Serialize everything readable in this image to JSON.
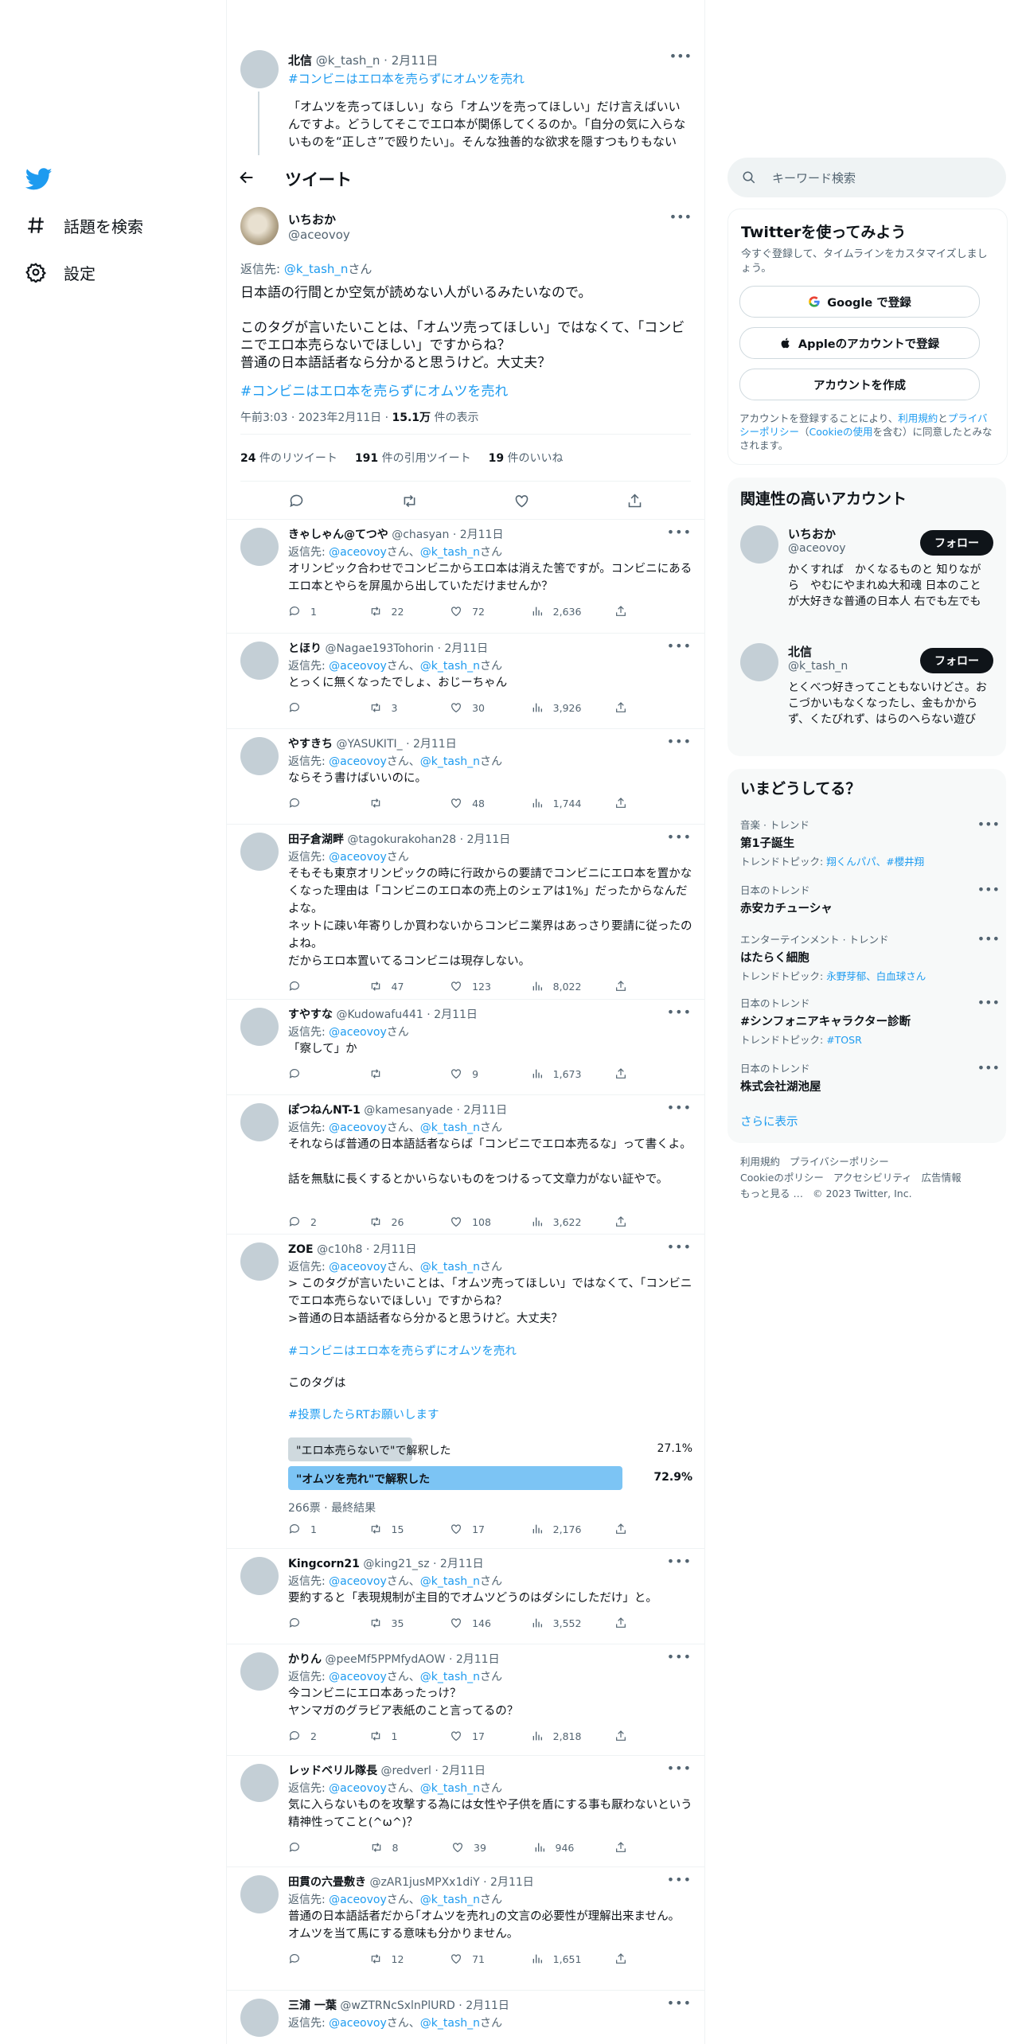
{
  "colors": {
    "accent": "#1d9bf0",
    "text": "#0f1419",
    "muted": "#536471",
    "poll_winner": "#7cc4f4",
    "poll_other": "#cfd9de"
  },
  "nav": {
    "explore": "話題を検索",
    "settings": "設定"
  },
  "parent": {
    "name": "北信",
    "handle": "@k_tash_n",
    "date": "· 2月11日",
    "hashtag": "#コンビニはエロ本を売らずにオムツを売れ",
    "text": "「オムツを売ってほしい」なら「オムツを売ってほしい」だけ言えばいいんですよ。どうしてそこでエロ本が関係してくるのか。「自分の気に入らないものを“正しさ”で殴りたい」。そんな独善的な欲求を隠すつもりもないんですね。"
  },
  "header": {
    "title": "ツイート"
  },
  "main": {
    "name": "いちおか",
    "handle": "@aceovoy",
    "reply_prefix": "返信先: ",
    "reply_to": "@k_tash_n",
    "reply_suffix": "さん",
    "line1": "日本語の行間とか空気が読めない人がいるみたいなので。",
    "line2": "このタグが言いたいことは、「オムツ売ってほしい」ではなくて、「コンビニでエロ本売らないでほしい」ですからね？",
    "line3": "普通の日本語話者なら分かると思うけど。大丈夫？",
    "hashtag": "#コンビニはエロ本を売らずにオムツを売れ",
    "time": "午前3:03 · 2023年2月11日 · ",
    "views": "15.1万",
    "views_suffix": " 件の表示",
    "retweets": "24",
    "retweets_label": " 件のリツイート",
    "quotes": "191",
    "quotes_label": " 件の引用ツイート",
    "likes": "19",
    "likes_label": " 件のいいね"
  },
  "replies": [
    {
      "name": "きゃしゃん@てつや",
      "handle": "@chasyan",
      "date": "· 2月11日",
      "to": [
        "@aceovoy",
        "@k_tash_n"
      ],
      "text": "オリンピック合わせでコンビニからエロ本は消えた筈ですが。コンビニにあるエロ本とやらを屏風から出していただけませんか？",
      "reply": "1",
      "rt": "22",
      "like": "72",
      "views": "2,636"
    },
    {
      "name": "とほり",
      "handle": "@Nagae193Tohorin",
      "date": "· 2月11日",
      "to": [
        "@aceovoy",
        "@k_tash_n"
      ],
      "text": "とっくに無くなったでしょ、おじーちゃん",
      "reply": "",
      "rt": "3",
      "like": "30",
      "views": "3,926"
    },
    {
      "name": "やすきち",
      "handle": "@YASUKITI_",
      "date": "· 2月11日",
      "to": [
        "@aceovoy",
        "@k_tash_n"
      ],
      "text": "ならそう書けばいいのに。",
      "reply": "",
      "rt": "",
      "like": "48",
      "views": "1,744"
    },
    {
      "name": "田子倉湖畔",
      "handle": "@tagokurakohan28",
      "date": "· 2月11日",
      "to": [
        "@aceovoy"
      ],
      "text": "そもそも東京オリンピックの時に行政からの要請でコンビニにエロ本を置かなくなった理由は「コンビニのエロ本の売上のシェアは1%」だったからなんだよな。\nネットに疎い年寄りしか買わないからコンビニ業界はあっさり要請に従ったのよね。\nだからエロ本置いてるコンビニは現存しない。",
      "reply": "",
      "rt": "47",
      "like": "123",
      "views": "8,022"
    },
    {
      "name": "すやすな",
      "handle": "@Kudowafu441",
      "date": "· 2月11日",
      "to": [
        "@aceovoy"
      ],
      "text": "「察して」か",
      "reply": "",
      "rt": "",
      "like": "9",
      "views": "1,673"
    },
    {
      "name": "ぽつねんNT-1",
      "handle": "@kamesanyade",
      "date": "· 2月11日",
      "to": [
        "@aceovoy",
        "@k_tash_n"
      ],
      "text": "それならば普通の日本語話者ならば「コンビニでエロ本売るな」って書くよ。\n\n話を無駄に長くするとかいらないものをつけるって文章力がない証やで。",
      "reply": "2",
      "rt": "26",
      "like": "108",
      "views": "3,622"
    },
    {
      "name": "ZOE",
      "handle": "@c10h8",
      "date": "· 2月11日",
      "to": [
        "@aceovoy",
        "@k_tash_n"
      ],
      "text": "> このタグが言いたいことは、「オムツ売ってほしい」ではなくて、「コンビニでエロ本売らないでほしい」ですからね？\n>普通の日本語話者なら分かると思うけど。大丈夫？",
      "reply": "1",
      "rt": "15",
      "like": "17",
      "views": "2,176"
    },
    {
      "name": "Kingcorn21",
      "handle": "@king21_sz",
      "date": "· 2月11日",
      "to": [
        "@aceovoy",
        "@k_tash_n"
      ],
      "text": "要約すると「表現規制が主目的でオムツどうのはダシにしただけ」と。",
      "reply": "",
      "rt": "35",
      "like": "146",
      "views": "3,552"
    },
    {
      "name": "かりん",
      "handle": "@peeMf5PPMfydAOW",
      "date": "· 2月11日",
      "to": [
        "@aceovoy",
        "@k_tash_n"
      ],
      "text": "今コンビニにエロ本あったっけ？\nヤンマガのグラビア表紙のこと言ってるの？",
      "reply": "2",
      "rt": "1",
      "like": "17",
      "views": "2,818"
    },
    {
      "name": "レッドベリル隊長",
      "handle": "@redverl",
      "date": "· 2月11日",
      "to": [
        "@aceovoy",
        "@k_tash_n"
      ],
      "text": "気に入らないものを攻撃する為には女性や子供を盾にする事も厭わないという精神性ってこと(^ω^)？",
      "reply": "",
      "rt": "8",
      "like": "39",
      "views": "946"
    },
    {
      "name": "田貫の六畳敷き",
      "handle": "@zAR1jusMPXx1diY",
      "date": "· 2月11日",
      "to": [
        "@aceovoy",
        "@k_tash_n"
      ],
      "text": "普通の日本語話者だから｢オムツを売れ｣の文言の必要性が理解出来ません。\nオムツを当て馬にする意味も分かりません。",
      "reply": "",
      "rt": "12",
      "like": "71",
      "views": "1,651"
    },
    {
      "name": "三浦 一葉",
      "handle": "@wZTRNcSxlnPlURD",
      "date": "· 2月11日",
      "to": [
        "@aceovoy",
        "@k_tash_n"
      ],
      "text": "",
      "reply": "",
      "rt": "",
      "like": "",
      "views": ""
    }
  ],
  "zoe_extra": {
    "hashtag": "#コンビニはエロ本を売らずにオムツを売れ",
    "line": "このタグは",
    "hashtag2": "#投票したらRTお願いします",
    "poll": [
      {
        "label": "\"エロ本売らないで\"で解釈した",
        "pct": "27.1%",
        "value": 27.1
      },
      {
        "label": "\"オムツを売れ\"で解釈した",
        "pct": "72.9%",
        "value": 72.9
      }
    ],
    "poll_result": "266票 · 最終結果"
  },
  "reply_labels": {
    "to_prefix": "返信先: ",
    "san": "さん",
    "sep": "、"
  },
  "search": {
    "placeholder": "キーワード検索"
  },
  "signup": {
    "title": "Twitterを使ってみよう",
    "desc": "今すぐ登録して、タイムラインをカスタマイズしましょう。",
    "google": "Google で登録",
    "apple": "Appleのアカウントで登録",
    "create": "アカウントを作成",
    "terms_1": "アカウントを登録することにより、",
    "terms_link1": "利用規約",
    "terms_2": "と",
    "terms_link2": "プライバシーポリシー",
    "terms_3": "（",
    "terms_link3": "Cookieの使用",
    "terms_4": "を含む）に同意したとみなされます。"
  },
  "related": {
    "title": "関連性の高いアカウント",
    "accounts": [
      {
        "name": "いちおか",
        "handle": "@aceovoy",
        "bio": "かくすれば　かくなるものと 知りながら　やむにやまれぬ大和魂 日本のことが大好きな普通の日本人 右でも左でもありません 反日カルトが嫌い",
        "follow": "フォロー"
      },
      {
        "name": "北信",
        "handle": "@k_tash_n",
        "bio": "とくべつ好きってこともないけどさ。おこづかいもなくなったし、金もかからず、くたびれず、はらのへらない遊びとなると、これしかないもの。",
        "follow": "フォロー"
      }
    ]
  },
  "trends": {
    "title": "いまどうしてる？",
    "items": [
      {
        "cat": "音楽 · トレンド",
        "name": "第1子誕生",
        "topic_prefix": "トレンドトピック: ",
        "topic": "翔くんパパ、#櫻井翔"
      },
      {
        "cat": "日本のトレンド",
        "name": "赤安カチューシャ",
        "topic_prefix": "",
        "topic": ""
      },
      {
        "cat": "エンターテインメント · トレンド",
        "name": "はたらく細胞",
        "topic_prefix": "トレンドトピック: ",
        "topic": "永野芽郁、白血球さん"
      },
      {
        "cat": "日本のトレンド",
        "name": "#シンフォニアキャラクター診断",
        "topic_prefix": "トレンドトピック: ",
        "topic": "#TOSR"
      },
      {
        "cat": "日本のトレンド",
        "name": "株式会社湖池屋",
        "topic_prefix": "",
        "topic": ""
      }
    ],
    "show_more": "さらに表示"
  },
  "footer": {
    "links": [
      "利用規約",
      "プライバシーポリシー",
      "Cookieのポリシー",
      "アクセシビリティ",
      "広告情報",
      "もっと見る …"
    ],
    "copyright": "© 2023 Twitter, Inc."
  }
}
